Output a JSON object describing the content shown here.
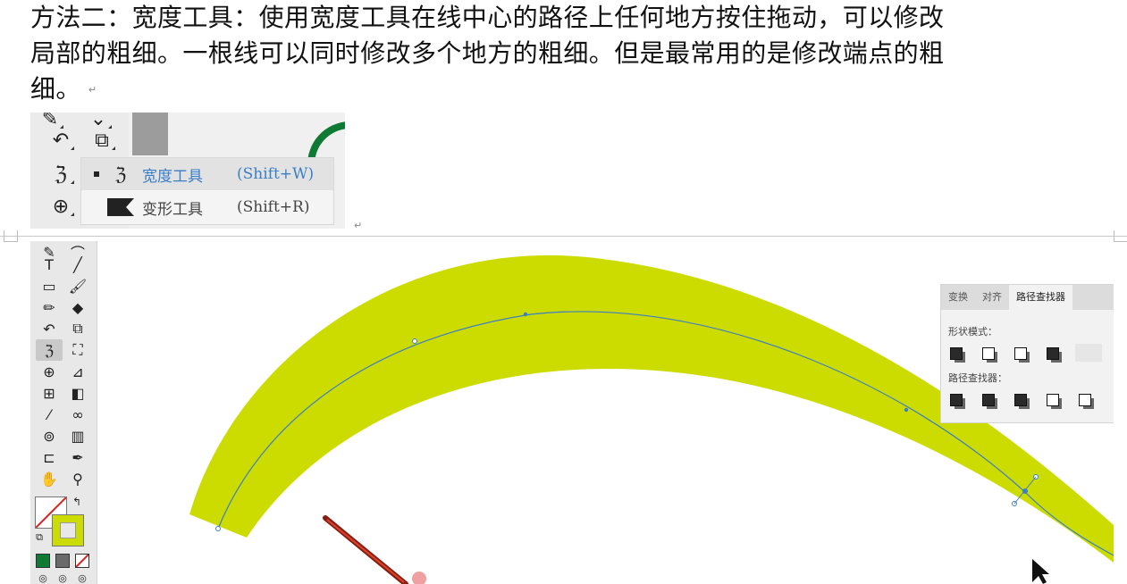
{
  "paragraph": {
    "line1": "方法二：宽度工具：使用宽度工具在线中心的路径上任何地方按住拖动，可以修改",
    "line2": "局部的粗细。一根线可以同时修改多个地方的粗细。但是最常用的是修改端点的粗",
    "line3": "细。"
  },
  "flyout_menu": {
    "items": [
      {
        "label": "宽度工具",
        "shortcut": "(Shift+W)",
        "icon": "width-tool-icon",
        "selected": true
      },
      {
        "label": "变形工具",
        "shortcut": "(Shift+R)",
        "icon": "warp-tool-icon",
        "selected": false
      }
    ]
  },
  "top_toolbar_icons": [
    "direct-select-icon",
    "rotate-icon",
    "scale-icon",
    "width-tool-icon",
    "shape-builder-icon"
  ],
  "bottom_toolbar": {
    "tools": [
      [
        "type-tool-icon",
        "line-tool-icon"
      ],
      [
        "rectangle-tool-icon",
        "paintbrush-tool-icon"
      ],
      [
        "pencil-tool-icon",
        "eraser-tool-icon"
      ],
      [
        "rotate-tool-icon",
        "scale-tool-icon"
      ],
      [
        "width-tool-icon",
        "free-transform-icon"
      ],
      [
        "shape-builder-icon",
        "perspective-grid-icon"
      ],
      [
        "mesh-tool-icon",
        "gradient-tool-icon"
      ],
      [
        "eyedropper-tool-icon",
        "blend-tool-icon"
      ],
      [
        "symbol-sprayer-icon",
        "column-graph-icon"
      ],
      [
        "artboard-tool-icon",
        "slice-tool-icon"
      ],
      [
        "hand-tool-icon",
        "zoom-tool-icon"
      ]
    ],
    "glyphs": {
      "type": "T",
      "line": "╱",
      "hand": "✋",
      "zoom": "🔍"
    }
  },
  "pathfinder_panel": {
    "tabs": [
      "变换",
      "对齐",
      "路径查找器"
    ],
    "active_tab": "路径查找器",
    "shape_modes_label": "形状模式：",
    "pathfinders_label": "路径查找器："
  },
  "colors": {
    "stroke_fill": "#cddc00",
    "path_line": "#3b7fc6",
    "flyout_selected_text": "#3b7fc6",
    "fill_swatch": "#cddc00",
    "green_mode": "#0f7a34"
  }
}
